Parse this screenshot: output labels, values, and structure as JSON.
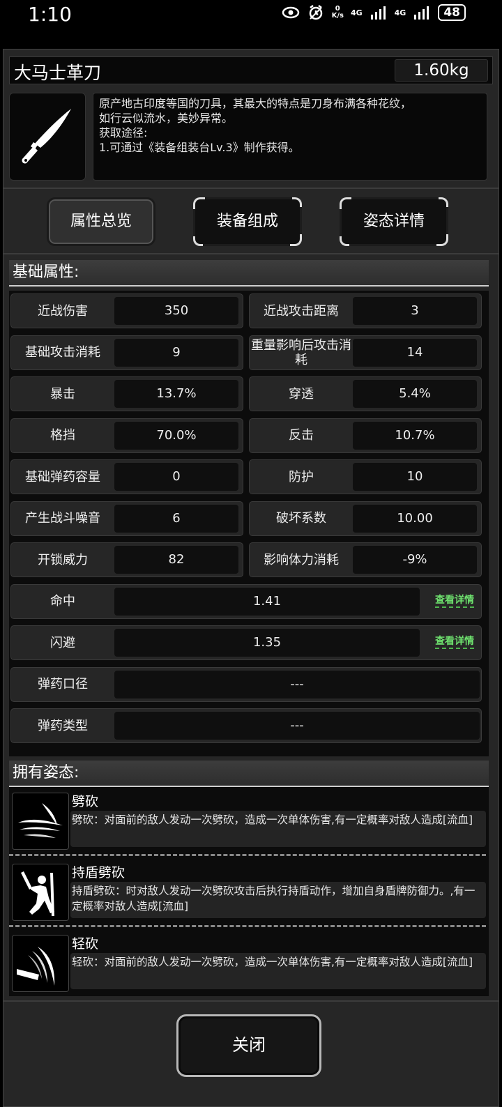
{
  "status_bar": {
    "time": "1:10",
    "net_speed": "0\nK/s",
    "net1": "4G",
    "net2": "4G",
    "battery": "48"
  },
  "item": {
    "name": "大马士革刀",
    "weight": "1.60kg",
    "icon": "knife-icon",
    "desc_lines": [
      "原产地古印度等国的刀具，其最大的特点是刀身布满各种花纹，",
      "如行云似流水，美妙异常。",
      "获取途径:",
      "1.可通过《装备组装台Lv.3》制作获得。"
    ]
  },
  "tabs": [
    {
      "label": "属性总览",
      "active": true
    },
    {
      "label": "装备组成",
      "active": false
    },
    {
      "label": "姿态详情",
      "active": false
    }
  ],
  "basic": {
    "title": "基础属性:",
    "pairs": [
      {
        "l1": "近战伤害",
        "v1": "350",
        "l2": "近战攻击距离",
        "v2": "3"
      },
      {
        "l1": "基础攻击消耗",
        "v1": "9",
        "l2": "重量影响后攻击消耗",
        "v2": "14"
      },
      {
        "l1": "暴击",
        "v1": "13.7%",
        "l2": "穿透",
        "v2": "5.4%"
      },
      {
        "l1": "格挡",
        "v1": "70.0%",
        "l2": "反击",
        "v2": "10.7%"
      },
      {
        "l1": "基础弹药容量",
        "v1": "0",
        "l2": "防护",
        "v2": "10"
      },
      {
        "l1": "产生战斗噪音",
        "v1": "6",
        "l2": "破坏系数",
        "v2": "10.00"
      },
      {
        "l1": "开锁威力",
        "v1": "82",
        "l2": "影响体力消耗",
        "v2": "-9%"
      }
    ],
    "wide": [
      {
        "label": "命中",
        "value": "1.41",
        "link": "查看详情"
      },
      {
        "label": "闪避",
        "value": "1.35",
        "link": "查看详情"
      },
      {
        "label": "弹药口径",
        "value": "---"
      },
      {
        "label": "弹药类型",
        "value": "---"
      }
    ]
  },
  "poses": {
    "title": "拥有姿态:",
    "items": [
      {
        "name": "劈砍",
        "icon": "chop-slash-icon",
        "text": "劈砍：对面前的敌人发动一次劈砍，造成一次单体伤害,有一定概率对敌人造成[流血]"
      },
      {
        "name": "持盾劈砍",
        "icon": "shield-chop-icon",
        "text": "持盾劈砍：时对敌人发动一次劈砍攻击后执行持盾动作，增加自身盾牌防御力。,有一定概率对敌人造成[流血]"
      },
      {
        "name": "轻砍",
        "icon": "light-chop-icon",
        "text": "轻砍：对面前的敌人发动一次劈砍，造成一次单体伤害,有一定概率对敌人造成[流血]"
      }
    ]
  },
  "close_label": "关闭"
}
